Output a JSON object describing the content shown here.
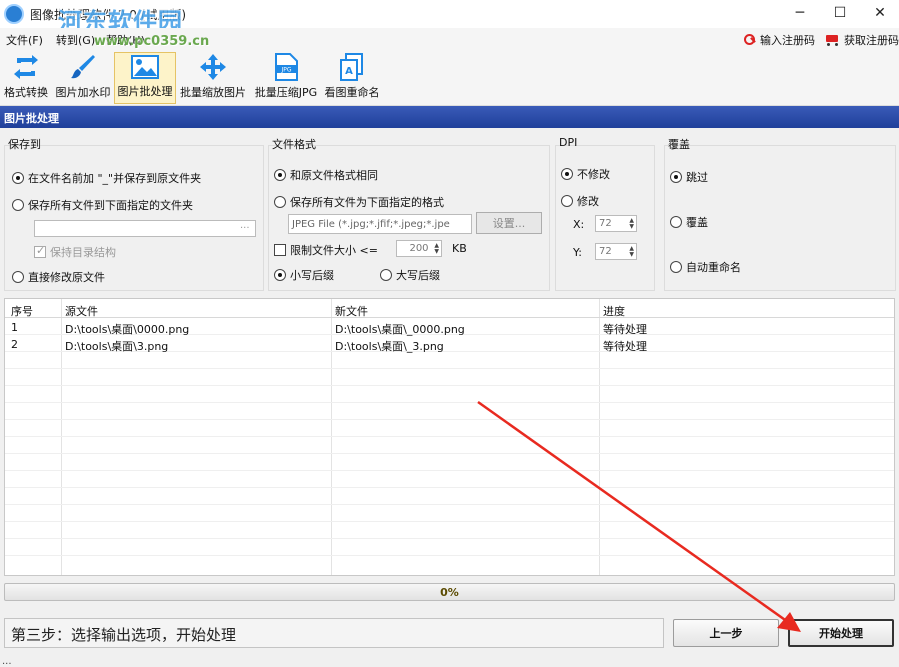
{
  "window": {
    "title": "图像批处理软件 2.0 (试用版)",
    "watermark": "河东软件园",
    "watermark_url": "www.pc0359.cn",
    "minimize": "─",
    "maximize": "☐",
    "close": "✕"
  },
  "menu": {
    "items": [
      "文件(F)",
      "转到(G)",
      "帮助(H)"
    ],
    "register_label": "输入注册码",
    "buy_label": "获取注册码"
  },
  "toolbar": {
    "tools": [
      {
        "label": "格式转换",
        "icon": "convert-icon"
      },
      {
        "label": "图片加水印",
        "icon": "brush-icon"
      },
      {
        "label": "图片批处理",
        "icon": "image-icon"
      },
      {
        "label": "批量缩放图片",
        "icon": "move-icon"
      },
      {
        "label": "批量压缩JPG",
        "icon": "jpg-icon"
      },
      {
        "label": "看图重命名",
        "icon": "rename-icon"
      }
    ]
  },
  "section_title": "图片批处理",
  "save_to": {
    "title": "保存到",
    "opt_prefix": "在文件名前加 \"_\"并保存到原文件夹",
    "opt_folder": "保存所有文件到下面指定的文件夹",
    "folder_value": "",
    "browse": "...",
    "keep_structure": "保持目录结构",
    "overwrite": "直接修改原文件"
  },
  "format": {
    "title": "文件格式",
    "same": "和原文件格式相同",
    "save_as": "保存所有文件为下面指定的格式",
    "format_value": "JPEG File (*.jpg;*.jfif;*.jpeg;*.jpe",
    "settings": "设置...",
    "limit_size": "限制文件大小 <=",
    "limit_value": "200",
    "limit_unit": "KB",
    "lower_ext": "小写后缀",
    "upper_ext": "大写后缀"
  },
  "dpi": {
    "title": "DPI",
    "unchanged": "不修改",
    "modify": "修改",
    "x_label": "X:",
    "x_value": "72",
    "y_label": "Y:",
    "y_value": "72"
  },
  "cover": {
    "title": "覆盖",
    "skip": "跳过",
    "overwrite": "覆盖",
    "auto_rename": "自动重命名"
  },
  "table": {
    "headers": [
      "序号",
      "源文件",
      "新文件",
      "进度"
    ],
    "rows": [
      [
        "1",
        "D:\\tools\\桌面\\0000.png",
        "D:\\tools\\桌面\\_0000.png",
        "等待处理"
      ],
      [
        "2",
        "D:\\tools\\桌面\\3.png",
        "D:\\tools\\桌面\\_3.png",
        "等待处理"
      ]
    ]
  },
  "progress": {
    "percent": 0,
    "label": "0%"
  },
  "status_text": "第三步：选择输出选项，开始处理",
  "buttons": {
    "prev": "上一步",
    "start": "开始处理"
  },
  "footer": "...",
  "colors": {
    "header_blue": "#1f3f9a",
    "arrow_red": "#e82a20",
    "toolbar_active": "#fdf3c9"
  }
}
